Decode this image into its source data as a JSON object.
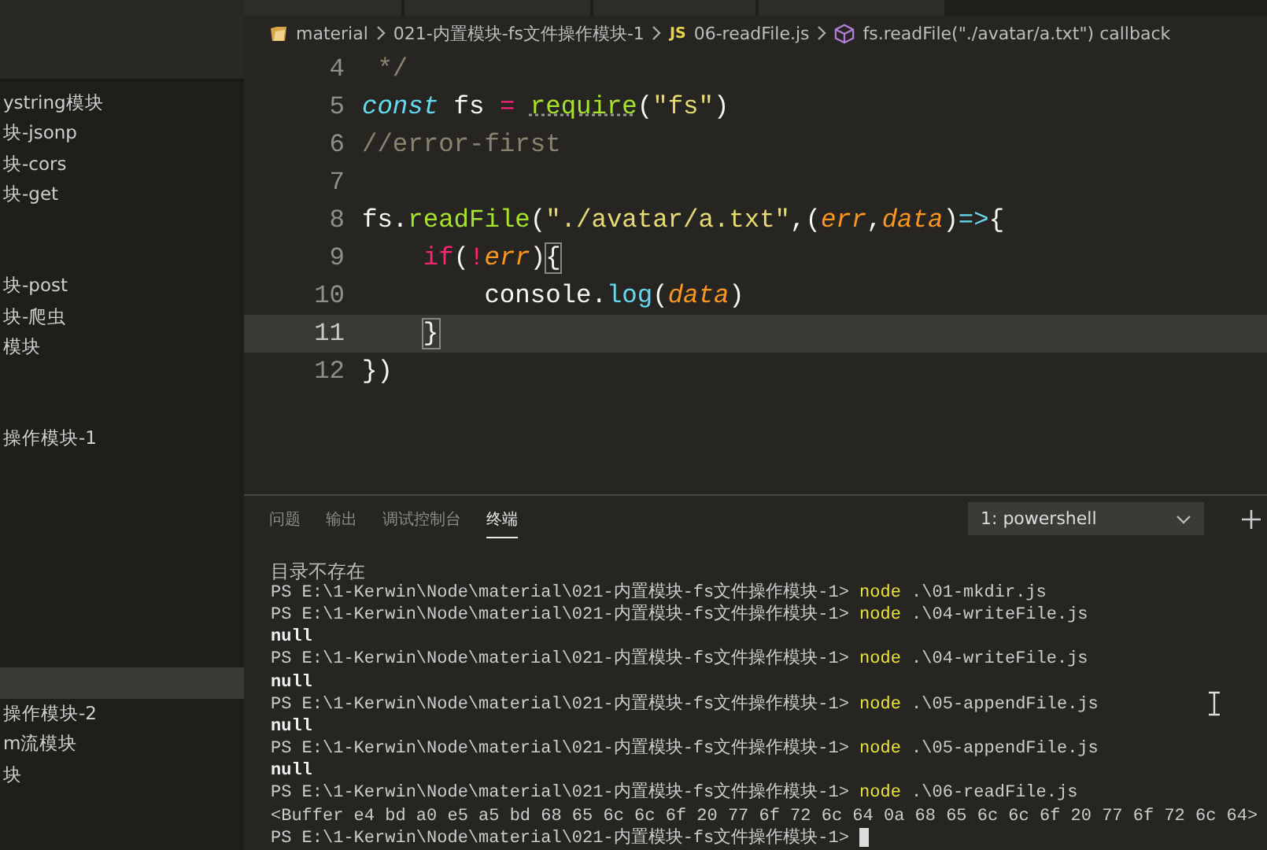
{
  "sidebar": {
    "items": [
      {
        "label": "ystring模块",
        "selected": false
      },
      {
        "label": "块-jsonp",
        "selected": false
      },
      {
        "label": "块-cors",
        "selected": false
      },
      {
        "label": "块-get",
        "selected": false
      },
      {
        "selected": false
      },
      {
        "selected": false
      },
      {
        "label": "块-post",
        "selected": false
      },
      {
        "label": "块-爬虫",
        "selected": false
      },
      {
        "label": "模块",
        "selected": false
      },
      {
        "selected": false
      },
      {
        "selected": false
      },
      {
        "label": "操作模块-1",
        "selected": false
      },
      {
        "selected": false
      },
      {
        "selected": false
      },
      {
        "selected": false
      },
      {
        "selected": false
      },
      {
        "selected": false
      },
      {
        "selected": false
      },
      {
        "selected": false
      },
      {
        "selected": true
      },
      {
        "label": "操作模块-2",
        "selected": false
      },
      {
        "label": "m流模块",
        "selected": false
      },
      {
        "label": "块",
        "selected": false
      }
    ]
  },
  "breadcrumb": [
    {
      "kind": "folder",
      "label": "material"
    },
    {
      "kind": "folder-path",
      "label": "021-内置模块-fs文件操作模块-1"
    },
    {
      "kind": "js-file",
      "badge": "JS",
      "label": "06-readFile.js"
    },
    {
      "kind": "symbol",
      "label": "fs.readFile(\"./avatar/a.txt\") callback"
    }
  ],
  "editor": {
    "lines": [
      {
        "number": "4",
        "current": false,
        "tokens": [
          {
            "kind": "comment",
            "text": " */"
          }
        ]
      },
      {
        "number": "5",
        "current": false,
        "tokens": [
          {
            "kind": "keyword",
            "text": "const"
          },
          {
            "kind": "plain",
            "text": " fs "
          },
          {
            "kind": "operator",
            "text": "= "
          },
          {
            "kind": "function-hint",
            "text": "require"
          },
          {
            "kind": "plain",
            "text": "("
          },
          {
            "kind": "string",
            "text": "\"fs\""
          },
          {
            "kind": "plain",
            "text": ")"
          }
        ]
      },
      {
        "number": "6",
        "current": false,
        "tokens": [
          {
            "kind": "comment",
            "text": "//error-first"
          }
        ]
      },
      {
        "number": "7",
        "current": false
      },
      {
        "number": "8",
        "current": false,
        "tokens": [
          {
            "kind": "plain",
            "text": "fs."
          },
          {
            "kind": "function",
            "text": "readFile"
          },
          {
            "kind": "plain",
            "text": "("
          },
          {
            "kind": "string",
            "text": "\"./avatar/a.txt\""
          },
          {
            "kind": "plain",
            "text": ",("
          },
          {
            "kind": "param",
            "text": "err"
          },
          {
            "kind": "plain",
            "text": ","
          },
          {
            "kind": "param",
            "text": "data"
          },
          {
            "kind": "plain",
            "text": ")"
          },
          {
            "kind": "arrow",
            "text": "=>"
          },
          {
            "kind": "plain",
            "text": "{"
          }
        ]
      },
      {
        "number": "9",
        "current": false,
        "tokens": [
          {
            "kind": "control",
            "text": "    if"
          },
          {
            "kind": "plain",
            "text": "("
          },
          {
            "kind": "operator",
            "text": "!"
          },
          {
            "kind": "param",
            "text": "err"
          },
          {
            "kind": "plain",
            "text": ")"
          },
          {
            "kind": "bracket-match",
            "text": "{"
          }
        ]
      },
      {
        "number": "10",
        "current": false,
        "tokens": [
          {
            "kind": "plain",
            "text": "        console."
          },
          {
            "kind": "method",
            "text": "log"
          },
          {
            "kind": "plain",
            "text": "("
          },
          {
            "kind": "param",
            "text": "data"
          },
          {
            "kind": "plain",
            "text": ")"
          }
        ]
      },
      {
        "number": "11",
        "current": true,
        "tokens": [
          {
            "kind": "bracket-match",
            "text": "    }"
          }
        ]
      },
      {
        "number": "12",
        "current": false,
        "tokens": [
          {
            "kind": "plain",
            "text": "})"
          }
        ]
      }
    ]
  },
  "panel": {
    "tabs": [
      {
        "label": "问题",
        "selected": false
      },
      {
        "label": "输出",
        "selected": false
      },
      {
        "label": "调试控制台",
        "selected": false
      },
      {
        "label": "终端",
        "selected": true
      }
    ],
    "terminal_select": {
      "value": "1: powershell"
    },
    "terminal": [
      {
        "kind": "message",
        "text": "目录不存在"
      },
      {
        "kind": "prompt",
        "prompt": "PS E:\\1-Kerwin\\Node\\material\\021-内置模块-fs文件操作模块-1> ",
        "command": "node",
        "args": " .\\01-mkdir.js"
      },
      {
        "kind": "prompt",
        "prompt": "PS E:\\1-Kerwin\\Node\\material\\021-内置模块-fs文件操作模块-1> ",
        "command": "node",
        "args": " .\\04-writeFile.js"
      },
      {
        "kind": "output",
        "text": "null"
      },
      {
        "kind": "prompt",
        "prompt": "PS E:\\1-Kerwin\\Node\\material\\021-内置模块-fs文件操作模块-1> ",
        "command": "node",
        "args": " .\\04-writeFile.js"
      },
      {
        "kind": "output",
        "text": "null"
      },
      {
        "kind": "prompt",
        "prompt": "PS E:\\1-Kerwin\\Node\\material\\021-内置模块-fs文件操作模块-1> ",
        "command": "node",
        "args": " .\\05-appendFile.js"
      },
      {
        "kind": "output",
        "text": "null"
      },
      {
        "kind": "prompt",
        "prompt": "PS E:\\1-Kerwin\\Node\\material\\021-内置模块-fs文件操作模块-1> ",
        "command": "node",
        "args": " .\\05-appendFile.js"
      },
      {
        "kind": "output",
        "text": "null"
      },
      {
        "kind": "prompt",
        "prompt": "PS E:\\1-Kerwin\\Node\\material\\021-内置模块-fs文件操作模块-1> ",
        "command": "node",
        "args": " .\\06-readFile.js"
      },
      {
        "kind": "plain",
        "text": "<Buffer e4 bd a0 e5 a5 bd 68 65 6c 6c 6f 20 77 6f 72 6c 64 0a 68 65 6c 6c 6f 20 77 6f 72 6c 64>"
      },
      {
        "kind": "prompt",
        "prompt": "PS E:\\1-Kerwin\\Node\\material\\021-内置模块-fs文件操作模块-1> ",
        "cursor": true
      }
    ]
  }
}
